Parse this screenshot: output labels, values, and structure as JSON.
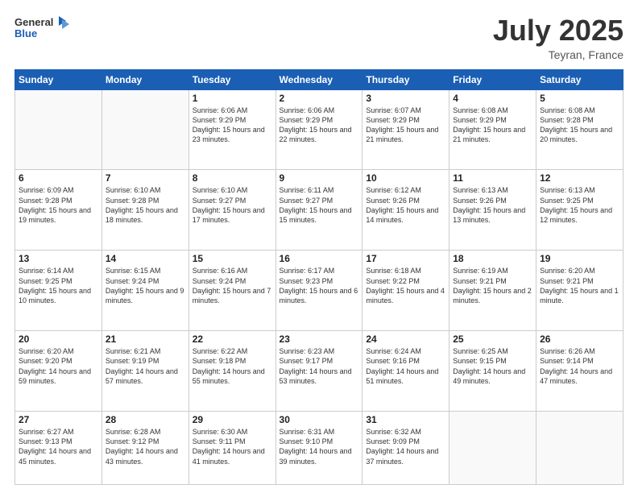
{
  "header": {
    "logo_line1": "General",
    "logo_line2": "Blue",
    "month": "July 2025",
    "location": "Teyran, France"
  },
  "days_of_week": [
    "Sunday",
    "Monday",
    "Tuesday",
    "Wednesday",
    "Thursday",
    "Friday",
    "Saturday"
  ],
  "weeks": [
    [
      {
        "day": "",
        "info": ""
      },
      {
        "day": "",
        "info": ""
      },
      {
        "day": "1",
        "info": "Sunrise: 6:06 AM\nSunset: 9:29 PM\nDaylight: 15 hours\nand 23 minutes."
      },
      {
        "day": "2",
        "info": "Sunrise: 6:06 AM\nSunset: 9:29 PM\nDaylight: 15 hours\nand 22 minutes."
      },
      {
        "day": "3",
        "info": "Sunrise: 6:07 AM\nSunset: 9:29 PM\nDaylight: 15 hours\nand 21 minutes."
      },
      {
        "day": "4",
        "info": "Sunrise: 6:08 AM\nSunset: 9:29 PM\nDaylight: 15 hours\nand 21 minutes."
      },
      {
        "day": "5",
        "info": "Sunrise: 6:08 AM\nSunset: 9:28 PM\nDaylight: 15 hours\nand 20 minutes."
      }
    ],
    [
      {
        "day": "6",
        "info": "Sunrise: 6:09 AM\nSunset: 9:28 PM\nDaylight: 15 hours\nand 19 minutes."
      },
      {
        "day": "7",
        "info": "Sunrise: 6:10 AM\nSunset: 9:28 PM\nDaylight: 15 hours\nand 18 minutes."
      },
      {
        "day": "8",
        "info": "Sunrise: 6:10 AM\nSunset: 9:27 PM\nDaylight: 15 hours\nand 17 minutes."
      },
      {
        "day": "9",
        "info": "Sunrise: 6:11 AM\nSunset: 9:27 PM\nDaylight: 15 hours\nand 15 minutes."
      },
      {
        "day": "10",
        "info": "Sunrise: 6:12 AM\nSunset: 9:26 PM\nDaylight: 15 hours\nand 14 minutes."
      },
      {
        "day": "11",
        "info": "Sunrise: 6:13 AM\nSunset: 9:26 PM\nDaylight: 15 hours\nand 13 minutes."
      },
      {
        "day": "12",
        "info": "Sunrise: 6:13 AM\nSunset: 9:25 PM\nDaylight: 15 hours\nand 12 minutes."
      }
    ],
    [
      {
        "day": "13",
        "info": "Sunrise: 6:14 AM\nSunset: 9:25 PM\nDaylight: 15 hours\nand 10 minutes."
      },
      {
        "day": "14",
        "info": "Sunrise: 6:15 AM\nSunset: 9:24 PM\nDaylight: 15 hours\nand 9 minutes."
      },
      {
        "day": "15",
        "info": "Sunrise: 6:16 AM\nSunset: 9:24 PM\nDaylight: 15 hours\nand 7 minutes."
      },
      {
        "day": "16",
        "info": "Sunrise: 6:17 AM\nSunset: 9:23 PM\nDaylight: 15 hours\nand 6 minutes."
      },
      {
        "day": "17",
        "info": "Sunrise: 6:18 AM\nSunset: 9:22 PM\nDaylight: 15 hours\nand 4 minutes."
      },
      {
        "day": "18",
        "info": "Sunrise: 6:19 AM\nSunset: 9:21 PM\nDaylight: 15 hours\nand 2 minutes."
      },
      {
        "day": "19",
        "info": "Sunrise: 6:20 AM\nSunset: 9:21 PM\nDaylight: 15 hours\nand 1 minute."
      }
    ],
    [
      {
        "day": "20",
        "info": "Sunrise: 6:20 AM\nSunset: 9:20 PM\nDaylight: 14 hours\nand 59 minutes."
      },
      {
        "day": "21",
        "info": "Sunrise: 6:21 AM\nSunset: 9:19 PM\nDaylight: 14 hours\nand 57 minutes."
      },
      {
        "day": "22",
        "info": "Sunrise: 6:22 AM\nSunset: 9:18 PM\nDaylight: 14 hours\nand 55 minutes."
      },
      {
        "day": "23",
        "info": "Sunrise: 6:23 AM\nSunset: 9:17 PM\nDaylight: 14 hours\nand 53 minutes."
      },
      {
        "day": "24",
        "info": "Sunrise: 6:24 AM\nSunset: 9:16 PM\nDaylight: 14 hours\nand 51 minutes."
      },
      {
        "day": "25",
        "info": "Sunrise: 6:25 AM\nSunset: 9:15 PM\nDaylight: 14 hours\nand 49 minutes."
      },
      {
        "day": "26",
        "info": "Sunrise: 6:26 AM\nSunset: 9:14 PM\nDaylight: 14 hours\nand 47 minutes."
      }
    ],
    [
      {
        "day": "27",
        "info": "Sunrise: 6:27 AM\nSunset: 9:13 PM\nDaylight: 14 hours\nand 45 minutes."
      },
      {
        "day": "28",
        "info": "Sunrise: 6:28 AM\nSunset: 9:12 PM\nDaylight: 14 hours\nand 43 minutes."
      },
      {
        "day": "29",
        "info": "Sunrise: 6:30 AM\nSunset: 9:11 PM\nDaylight: 14 hours\nand 41 minutes."
      },
      {
        "day": "30",
        "info": "Sunrise: 6:31 AM\nSunset: 9:10 PM\nDaylight: 14 hours\nand 39 minutes."
      },
      {
        "day": "31",
        "info": "Sunrise: 6:32 AM\nSunset: 9:09 PM\nDaylight: 14 hours\nand 37 minutes."
      },
      {
        "day": "",
        "info": ""
      },
      {
        "day": "",
        "info": ""
      }
    ]
  ]
}
